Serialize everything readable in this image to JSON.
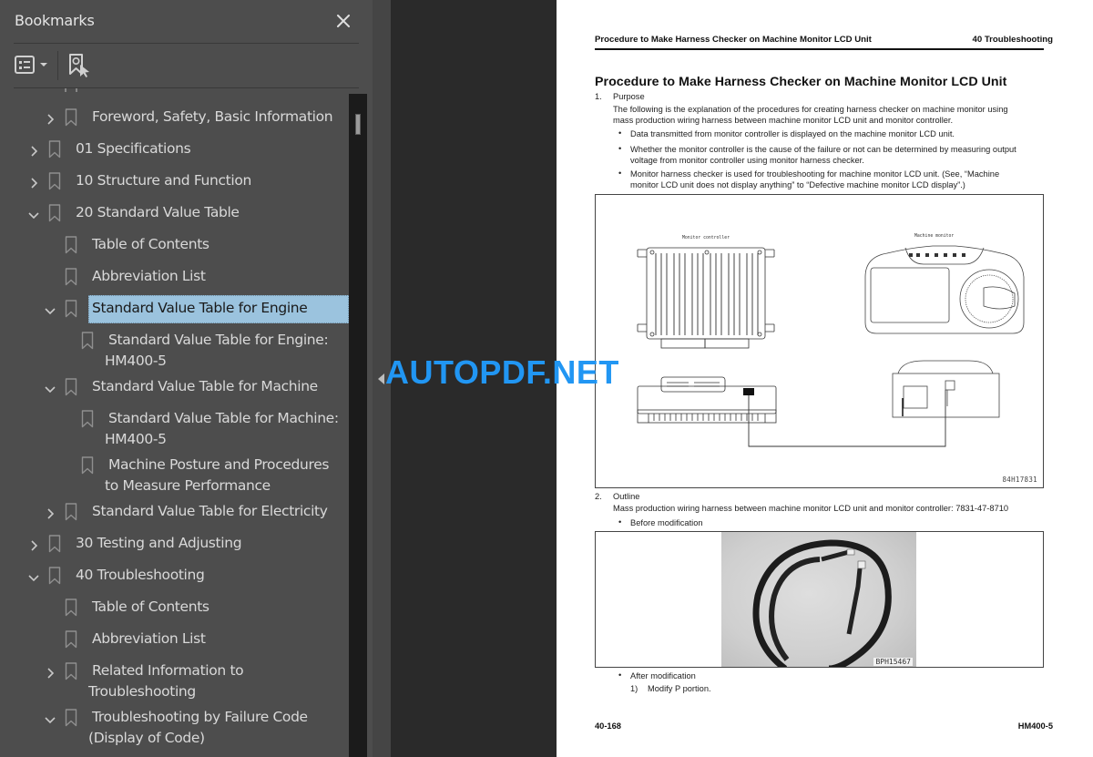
{
  "sidebar": {
    "title": "Bookmarks",
    "close_icon": "close-icon",
    "toolbar": {
      "options_icon": "list-options-icon",
      "find_current_icon": "find-current-bookmark-icon"
    },
    "items": [
      {
        "label": "Foreword, Safety, Basic Information",
        "expander": "collapsed",
        "level": 2
      },
      {
        "label": "01 Specifications",
        "expander": "collapsed",
        "level": 1
      },
      {
        "label": "10 Structure and Function",
        "expander": "collapsed",
        "level": 1
      },
      {
        "label": "20 Standard Value Table",
        "expander": "expanded",
        "level": 1
      },
      {
        "label": "Table of Contents",
        "expander": "none",
        "level": 2
      },
      {
        "label": "Abbreviation List",
        "expander": "none",
        "level": 2
      },
      {
        "label": "Standard Value Table for Engine",
        "expander": "expanded",
        "level": 2,
        "selected": true
      },
      {
        "label": "Standard Value Table for Engine: HM400-5",
        "expander": "none",
        "level": 3
      },
      {
        "label": "Standard Value Table for Machine",
        "expander": "expanded",
        "level": 2
      },
      {
        "label": "Standard Value Table for Machine: HM400-5",
        "expander": "none",
        "level": 3
      },
      {
        "label": "Machine Posture and Procedures to Measure Performance",
        "expander": "none",
        "level": 3
      },
      {
        "label": "Standard Value Table for Electricity",
        "expander": "collapsed",
        "level": 2
      },
      {
        "label": "30 Testing and Adjusting",
        "expander": "collapsed",
        "level": 1
      },
      {
        "label": "40 Troubleshooting",
        "expander": "expanded",
        "level": 1
      },
      {
        "label": "Table of Contents",
        "expander": "none",
        "level": 2
      },
      {
        "label": "Abbreviation List",
        "expander": "none",
        "level": 2
      },
      {
        "label": "Related Information to Troubleshooting",
        "expander": "collapsed",
        "level": 2
      },
      {
        "label": "Troubleshooting by Failure Code (Display of Code)",
        "expander": "expanded",
        "level": 2
      }
    ]
  },
  "watermark": "AUTOPDF.NET",
  "page": {
    "running_head_left": "Procedure to Make Harness Checker on Machine Monitor LCD Unit",
    "running_head_right": "40 Troubleshooting",
    "title": "Procedure to Make Harness Checker on Machine Monitor LCD Unit",
    "section1": {
      "number": "1.",
      "heading": "Purpose",
      "body_line1": "The following is the explanation of the procedures for creating harness checker on machine monitor using",
      "body_line2": "mass production wiring harness between machine monitor LCD unit and monitor controller.",
      "bullets": [
        {
          "line1": "Data transmitted from monitor controller is displayed on the machine monitor LCD unit.",
          "line2": ""
        },
        {
          "line1": "Whether the monitor controller is the cause of the failure or not can be determined by measuring output",
          "line2": "voltage from monitor controller using monitor harness checker."
        },
        {
          "line1": "Monitor harness checker is used for troubleshooting for machine monitor LCD unit. (See, “Machine",
          "line2": "monitor LCD unit does not display anything” to “Defective machine monitor LCD display”.)"
        }
      ]
    },
    "figure1": {
      "label_left": "Monitor controller",
      "label_right": "Machine monitor",
      "code": "84H17831"
    },
    "section2": {
      "number": "2.",
      "heading": "Outline",
      "body": "Mass production wiring harness between machine monitor LCD unit and monitor controller: 7831-47-8710",
      "bullet_before": "Before modification",
      "bullet_after": "After modification",
      "step_number": "1)",
      "step_text": "Modify P portion."
    },
    "figure2": {
      "code": "BPH15467"
    },
    "footer_left": "40-168",
    "footer_right": "HM400-5"
  }
}
